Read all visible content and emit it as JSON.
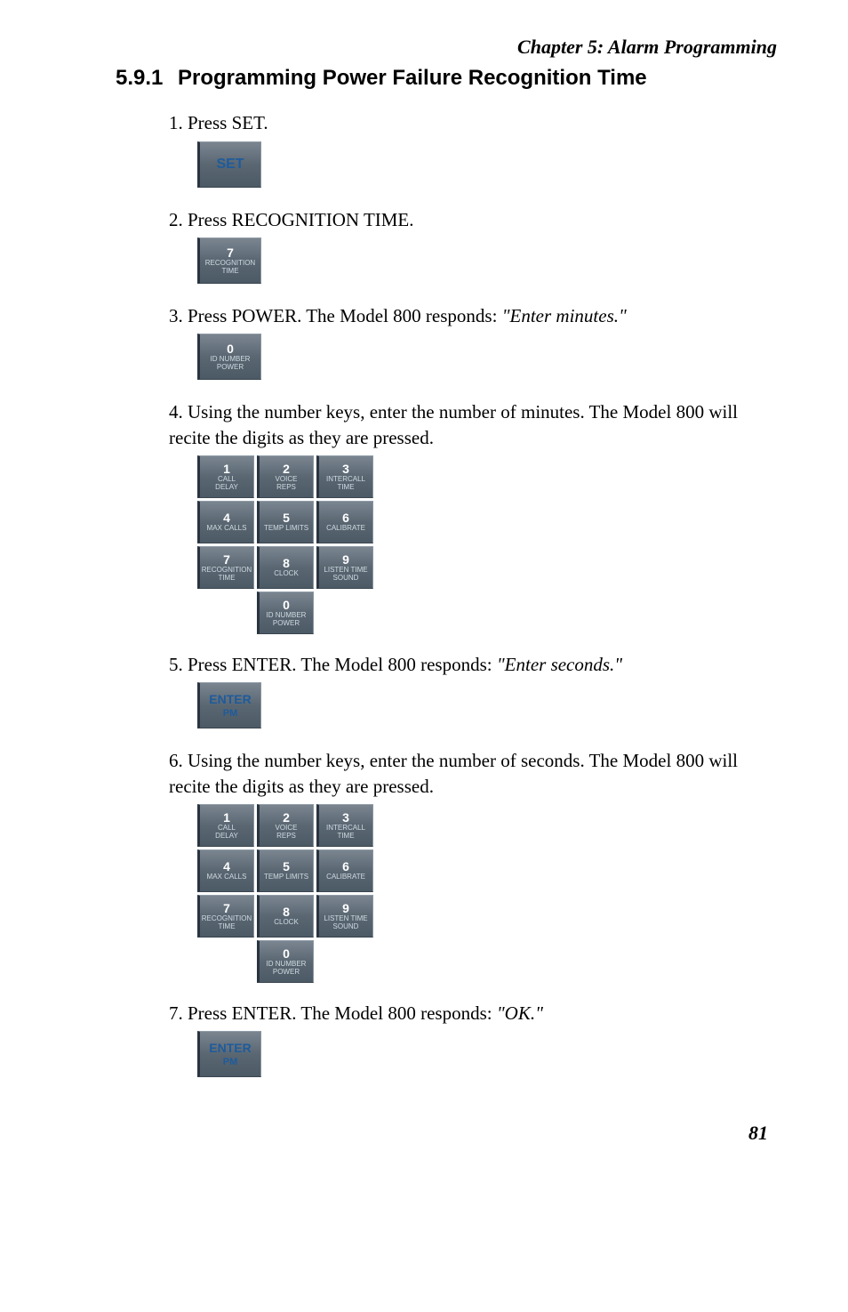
{
  "chapter_header": "Chapter 5: Alarm Programming",
  "section": {
    "number": "5.9.1",
    "title": "Programming Power Failure Recognition Time"
  },
  "steps": {
    "s1": {
      "num": "1.",
      "text": "Press SET."
    },
    "s2": {
      "num": "2.",
      "text": "Press RECOGNITION TIME."
    },
    "s3": {
      "num": "3.",
      "text": "Press POWER. The Model 800 responds: ",
      "response": "\"Enter minutes.\""
    },
    "s4": {
      "num": "4.",
      "text": "Using the number keys, enter the number of minutes. The Model 800 will recite the digits as they are pressed."
    },
    "s5": {
      "num": "5.",
      "text": "Press ENTER. The Model 800 responds: ",
      "response": "\"Enter seconds.\""
    },
    "s6": {
      "num": "6.",
      "text": "Using the number keys, enter the number of seconds. The Model 800 will recite the digits as they are pressed."
    },
    "s7": {
      "num": "7.",
      "text": "Press ENTER. The Model 800 responds: ",
      "response": "\"OK.\""
    }
  },
  "keys": {
    "set": "SET",
    "enter": {
      "main": "ENTER",
      "sub": "PM"
    },
    "k1": {
      "d": "1",
      "l1": "CALL",
      "l2": "DELAY"
    },
    "k2": {
      "d": "2",
      "l1": "VOICE",
      "l2": "REPS"
    },
    "k3": {
      "d": "3",
      "l1": "INTERCALL",
      "l2": "TIME"
    },
    "k4": {
      "d": "4",
      "l1": "MAX CALLS",
      "l2": ""
    },
    "k5": {
      "d": "5",
      "l1": "TEMP LIMITS",
      "l2": ""
    },
    "k6": {
      "d": "6",
      "l1": "CALIBRATE",
      "l2": ""
    },
    "k7": {
      "d": "7",
      "l1": "RECOGNITION",
      "l2": "TIME"
    },
    "k8": {
      "d": "8",
      "l1": "CLOCK",
      "l2": ""
    },
    "k9": {
      "d": "9",
      "l1": "LISTEN TIME",
      "l2": "SOUND"
    },
    "k0": {
      "d": "0",
      "l1": "ID NUMBER",
      "l2": "POWER"
    }
  },
  "page_number": "81"
}
